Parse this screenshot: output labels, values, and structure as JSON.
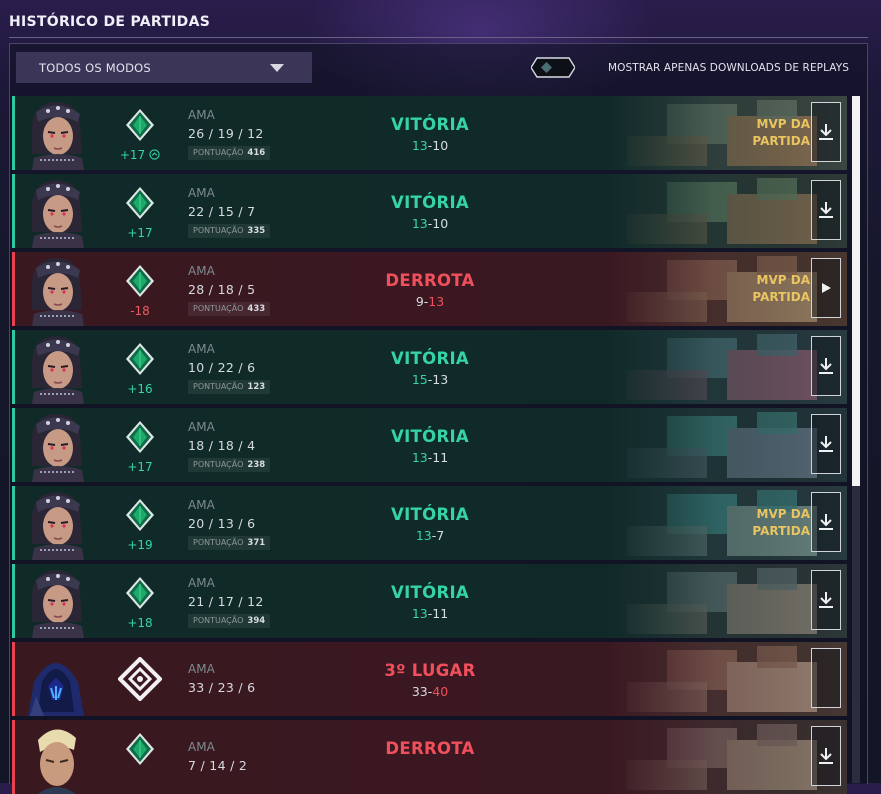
{
  "header": {
    "title": "HISTÓRICO DE PARTIDAS"
  },
  "filter": {
    "selected": "TODOS OS MODOS"
  },
  "toggle": {
    "label": "MOSTRAR APENAS DOWNLOADS DE REPLAYS",
    "on": false
  },
  "score_label": "PONTUAÇÃO",
  "matches": [
    {
      "outcome": "win",
      "result": "VITÓRIA",
      "rr": "+17",
      "rr_icon": "shield-up-icon",
      "mode": "AMA",
      "kda": "26 / 19 / 12",
      "score": "416",
      "team": "13",
      "enemy": "10",
      "mvp": "MVP DA PARTIDA",
      "action": "download",
      "agent": "agent-portrait-reyna",
      "rank": "emerald-rank-icon",
      "map": "map-thumbnail-1"
    },
    {
      "outcome": "win",
      "result": "VITÓRIA",
      "rr": "+17",
      "mode": "AMA",
      "kda": "22 / 15 / 7",
      "score": "335",
      "team": "13",
      "enemy": "10",
      "mvp": "",
      "action": "download",
      "agent": "agent-portrait-reyna",
      "rank": "emerald-rank-icon",
      "map": "map-thumbnail-2"
    },
    {
      "outcome": "loss",
      "result": "DERROTA",
      "rr": "-18",
      "mode": "AMA",
      "kda": "28 / 18 / 5",
      "score": "433",
      "team": "9",
      "enemy": "13",
      "mvp": "MVP DA PARTIDA",
      "action": "play",
      "agent": "agent-portrait-reyna",
      "rank": "emerald-rank-icon",
      "map": "map-thumbnail-3"
    },
    {
      "outcome": "win",
      "result": "VITÓRIA",
      "rr": "+16",
      "mode": "AMA",
      "kda": "10 / 22 / 6",
      "score": "123",
      "team": "15",
      "enemy": "13",
      "mvp": "",
      "action": "download",
      "agent": "agent-portrait-reyna",
      "rank": "emerald-rank-icon",
      "map": "map-thumbnail-4"
    },
    {
      "outcome": "win",
      "result": "VITÓRIA",
      "rr": "+17",
      "mode": "AMA",
      "kda": "18 / 18 / 4",
      "score": "238",
      "team": "13",
      "enemy": "11",
      "mvp": "",
      "action": "download",
      "agent": "agent-portrait-reyna",
      "rank": "emerald-rank-icon",
      "map": "map-thumbnail-5"
    },
    {
      "outcome": "win",
      "result": "VITÓRIA",
      "rr": "+19",
      "mode": "AMA",
      "kda": "20 / 13 / 6",
      "score": "371",
      "team": "13",
      "enemy": "7",
      "mvp": "MVP DA PARTIDA",
      "action": "download",
      "agent": "agent-portrait-reyna",
      "rank": "emerald-rank-icon",
      "map": "map-thumbnail-6"
    },
    {
      "outcome": "win",
      "result": "VITÓRIA",
      "rr": "+18",
      "mode": "AMA",
      "kda": "21 / 17 / 12",
      "score": "394",
      "team": "13",
      "enemy": "11",
      "mvp": "",
      "action": "download",
      "agent": "agent-portrait-reyna",
      "rank": "emerald-rank-icon",
      "map": "map-thumbnail-7"
    },
    {
      "outcome": "loss",
      "result": "3º LUGAR",
      "rr": "",
      "mode": "AMA",
      "kda": "33 / 23 / 6",
      "score": "",
      "team": "33",
      "enemy": "40",
      "mvp": "",
      "action": "none",
      "agent": "agent-portrait-omen",
      "rank": "deathmatch-mode-icon",
      "map": "map-thumbnail-8"
    },
    {
      "outcome": "loss",
      "result": "DERROTA",
      "rr": "",
      "mode": "AMA",
      "kda": "7 / 14 / 2",
      "score": "",
      "team": "",
      "enemy": "",
      "mvp": "",
      "action": "download",
      "agent": "agent-portrait-sova",
      "rank": "emerald-rank-icon",
      "map": "map-thumbnail-9"
    }
  ],
  "colors": {
    "win": "#35d3a6",
    "loss": "#f0505c",
    "mvp": "#e9c561",
    "panel": "#3b3658"
  }
}
